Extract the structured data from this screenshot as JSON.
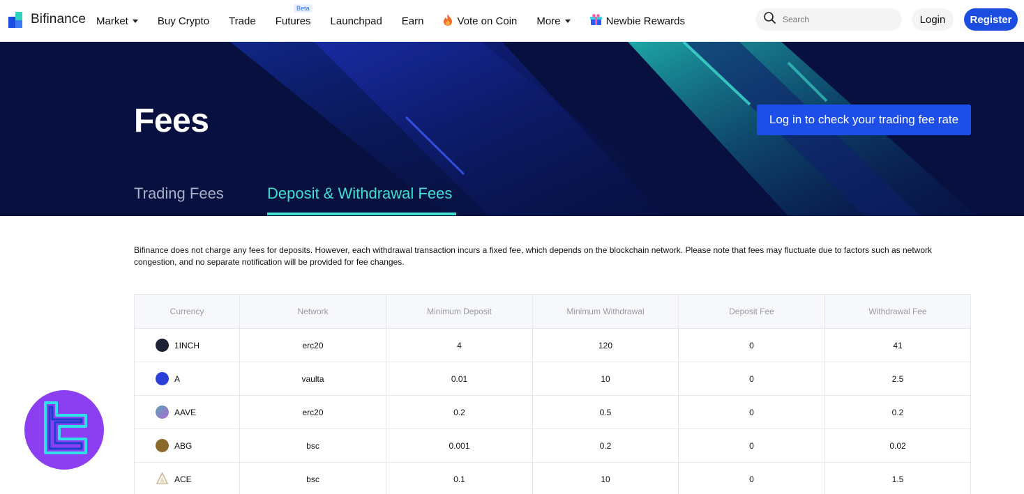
{
  "nav": {
    "brand": "Bifinance",
    "items": [
      {
        "label": "Market",
        "dropdown": true
      },
      {
        "label": "Buy Crypto"
      },
      {
        "label": "Trade"
      },
      {
        "label": "Futures",
        "badge": "Beta"
      },
      {
        "label": "Launchpad"
      },
      {
        "label": "Earn"
      },
      {
        "label": "Vote on Coin",
        "icon": "fire-icon"
      },
      {
        "label": "More",
        "dropdown": true
      },
      {
        "label": "Newbie Rewards",
        "icon": "gift-icon"
      }
    ],
    "search_placeholder": "Search",
    "login": "Login",
    "register": "Register"
  },
  "hero": {
    "title": "Fees",
    "cta": "Log in to check your trading fee rate",
    "tabs": [
      {
        "label": "Trading Fees",
        "active": false
      },
      {
        "label": "Deposit & Withdrawal Fees",
        "active": true
      }
    ]
  },
  "description": "Bifinance does not charge any fees for deposits. However, each withdrawal transaction incurs a fixed fee, which depends on the blockchain network. Please note that fees may fluctuate due to factors such as network congestion, and no separate notification will be provided for fee changes.",
  "table": {
    "headers": [
      "Currency",
      "Network",
      "Minimum Deposit",
      "Minimum Withdrawal",
      "Deposit Fee",
      "Withdrawal Fee"
    ],
    "rows": [
      {
        "currency": "1INCH",
        "network": "erc20",
        "min_deposit": "4",
        "min_withdrawal": "120",
        "deposit_fee": "0",
        "withdrawal_fee": "41",
        "icon_color": "#1b2233"
      },
      {
        "currency": "A",
        "network": "vaulta",
        "min_deposit": "0.01",
        "min_withdrawal": "10",
        "deposit_fee": "0",
        "withdrawal_fee": "2.5",
        "icon_color": "#2a3fd8"
      },
      {
        "currency": "AAVE",
        "network": "erc20",
        "min_deposit": "0.2",
        "min_withdrawal": "0.5",
        "deposit_fee": "0",
        "withdrawal_fee": "0.2",
        "icon_color": "#5aa3b8"
      },
      {
        "currency": "ABG",
        "network": "bsc",
        "min_deposit": "0.001",
        "min_withdrawal": "0.2",
        "deposit_fee": "0",
        "withdrawal_fee": "0.02",
        "icon_color": "#8a6a2a"
      },
      {
        "currency": "ACE",
        "network": "bsc",
        "min_deposit": "0.1",
        "min_withdrawal": "10",
        "deposit_fee": "0",
        "withdrawal_fee": "1.5",
        "icon_color": "#d9c9a8"
      }
    ]
  },
  "colors": {
    "brand_blue": "#1b4ee0",
    "hero_bg": "#07103f",
    "tab_active": "#3fe0d0",
    "watermark": "#8b3ff0"
  }
}
